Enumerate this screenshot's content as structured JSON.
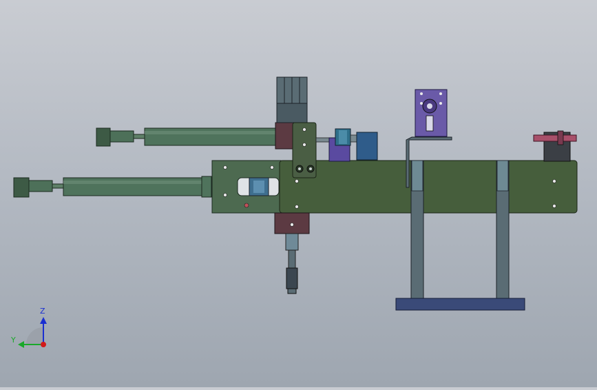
{
  "triad": {
    "z_label": "Z",
    "y_label": "Y",
    "z_color": "#1a2fd1",
    "y_color": "#1aa82a",
    "x_color": "#d11a1a"
  },
  "colors": {
    "background_top": "#c9ccd2",
    "background_bottom": "#9ea6b0",
    "plate_green": "#465e3c",
    "cylinder_green": "#4f735c",
    "stand_steel": "#5a6c74",
    "base_blue": "#3a4a78",
    "bracket_purple": "#6a5aa8",
    "valve_blue": "#2f5c8a",
    "pin_pink": "#a8506a",
    "block_maroon": "#5c3a42"
  }
}
